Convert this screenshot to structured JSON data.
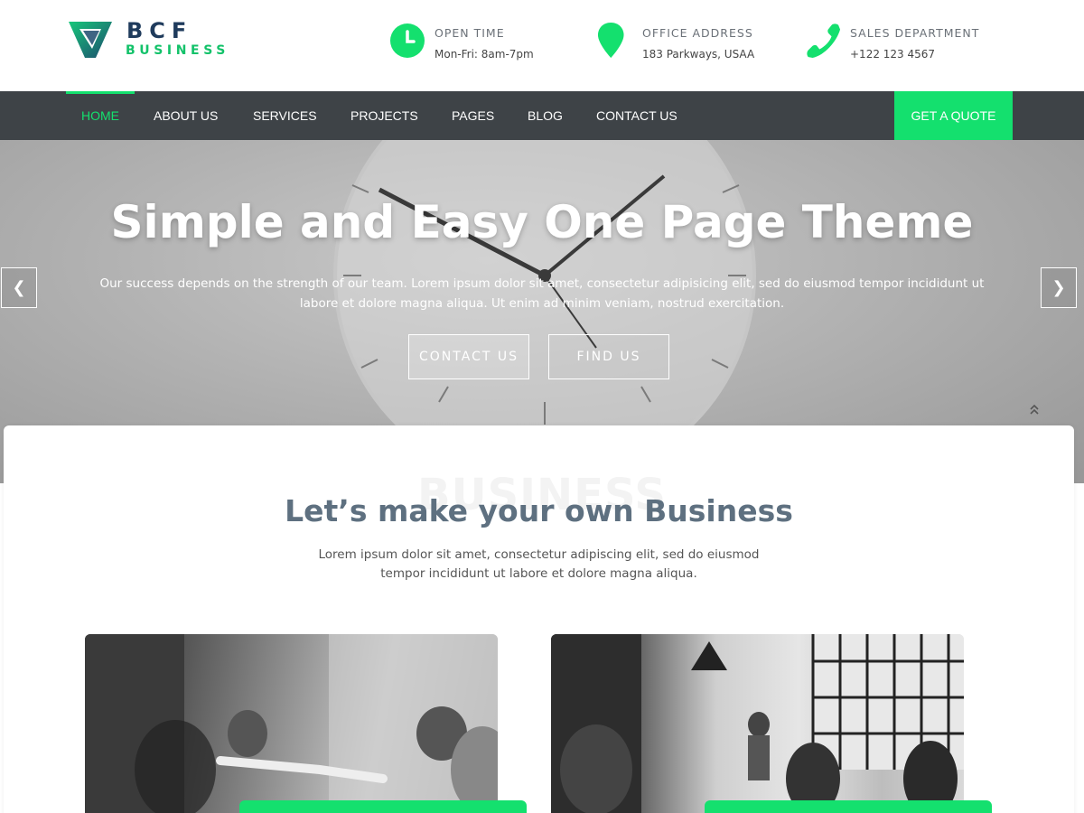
{
  "brand": {
    "name": "BCF",
    "tagline": "BUSINESS"
  },
  "header_info": [
    {
      "title": "OPEN TIME",
      "value": "Mon-Fri: 8am-7pm",
      "icon": "clock-icon"
    },
    {
      "title": "OFFICE ADDRESS",
      "value": "183 Parkways, USAA",
      "icon": "map-pin-icon"
    },
    {
      "title": "SALES DEPARTMENT",
      "value": "+122 123 4567",
      "icon": "phone-icon"
    }
  ],
  "nav": {
    "items": [
      "HOME",
      "ABOUT US",
      "SERVICES",
      "PROJECTS",
      "PAGES",
      "BLOG",
      "CONTACT US"
    ],
    "active": "HOME",
    "cta": "GET A QUOTE"
  },
  "hero": {
    "title": "Simple and Easy One Page Theme",
    "description": "Our success depends on the strength of our team. Lorem ipsum dolor sit amet, consectetur adipisicing elit, sed do eiusmod tempor incididunt ut labore et dolore magna aliqua. Ut enim ad minim veniam, nostrud exercitation.",
    "buttons": [
      "CONTACT US",
      "FIND US"
    ],
    "prev_arrow": "❮",
    "next_arrow": "❯"
  },
  "section": {
    "background_word": "BUSINESS",
    "title": "Let’s make your own Business",
    "description": "Lorem ipsum dolor sit amet, consectetur adipiscing elit, sed do eiusmod tempor incididunt ut labore et dolore magna aliqua."
  },
  "colors": {
    "accent": "#14e06e",
    "nav_bg": "#3e4347",
    "logo_dark": "#1f3b5c",
    "heading": "#5e7080"
  }
}
